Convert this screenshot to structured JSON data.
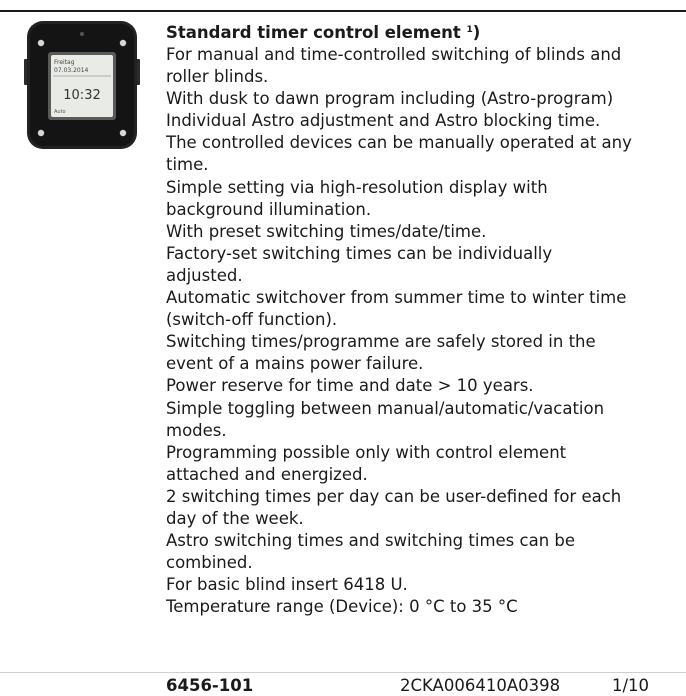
{
  "product": {
    "title": "Standard timer control element",
    "footnote_mark": "1",
    "title_suffix": ")",
    "description_lines": [
      "For manual and time-controlled switching of blinds and",
      "roller blinds.",
      "With dusk to dawn program including (Astro-program)",
      "Individual Astro adjustment and Astro blocking time.",
      "The controlled devices can be manually operated at any",
      "time.",
      "Simple setting via high-resolution display with",
      "background illumination.",
      "With preset switching times/date/time.",
      "Factory-set switching times can be individually",
      "adjusted.",
      "Automatic switchover from summer time to winter time",
      "(switch-off function).",
      "Switching times/programme are safely stored in the",
      "event of a mains power failure.",
      "Power reserve for time and date > 10 years.",
      "Simple toggling between manual/automatic/vacation",
      "modes.",
      "Programming possible only with control element",
      "attached and energized.",
      "2 switching times per day can be user-defined for each",
      "day of the week.",
      "Astro switching times and switching times can be",
      "combined.",
      "For basic blind insert 6418 U.",
      "Temperature range (Device): 0 °C to 35 °C"
    ]
  },
  "device_display": {
    "day": "Freitag",
    "date": "07.03.2014",
    "time": "10:32",
    "mode": "Auto"
  },
  "footer": {
    "article_number": "6456-101",
    "order_code": "2CKA006410A0398",
    "pack": "1/10"
  }
}
